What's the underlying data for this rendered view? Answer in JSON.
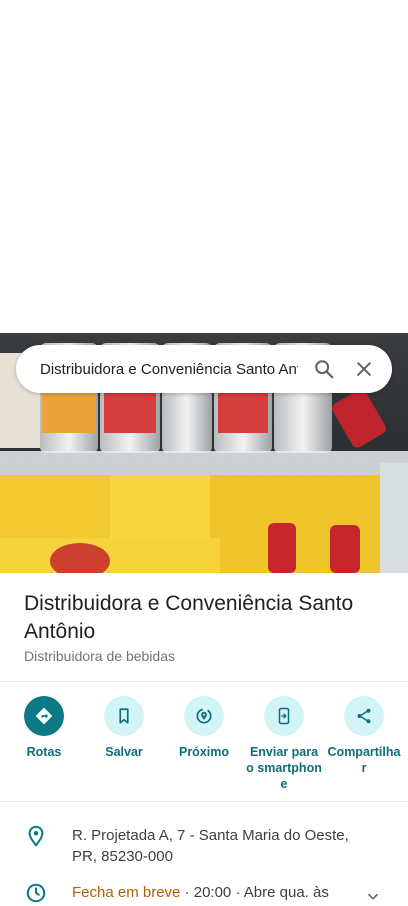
{
  "search": {
    "query": "Distribuidora e Conveniência Santo Antônio"
  },
  "place": {
    "title": "Distribuidora e Conveniência Santo Antônio",
    "category": "Distribuidora de bebidas"
  },
  "actions": [
    {
      "label": "Rotas",
      "icon": "directions-icon"
    },
    {
      "label": "Salvar",
      "icon": "bookmark-icon"
    },
    {
      "label": "Próximo",
      "icon": "nearby-icon"
    },
    {
      "label": "Enviar para o smartphone",
      "icon": "send-to-phone-icon"
    },
    {
      "label": "Compartilhar",
      "icon": "share-icon"
    }
  ],
  "address": {
    "text": "R. Projetada A, 7 - Santa Maria do Oeste, PR, 85230-000"
  },
  "hours": {
    "status": "Fecha em breve",
    "sep1": " · ",
    "close_time": "20:00",
    "sep2": " · ",
    "next": "Abre qua. às"
  },
  "colors": {
    "accent": "#0b7a85",
    "action_bg": "#d2f4f9",
    "warning": "#b06000"
  }
}
